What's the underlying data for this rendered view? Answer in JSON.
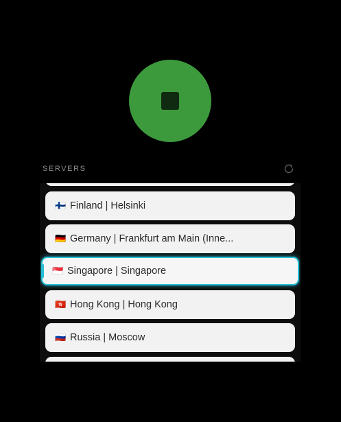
{
  "section": {
    "label": "SERVERS"
  },
  "icons": {
    "power": "stop-square-icon",
    "refresh": "refresh-icon"
  },
  "colors": {
    "connected": "#3c9a3c",
    "selected_border": "#27bfd4"
  },
  "servers": [
    {
      "flag": "🇫🇮",
      "name": "Finland | Helsinki",
      "selected": false
    },
    {
      "flag": "🇩🇪",
      "name": "Germany | Frankfurt am Main (Inne...",
      "selected": false
    },
    {
      "flag": "🇸🇬",
      "name": "Singapore | Singapore",
      "selected": true
    },
    {
      "flag": "🇭🇰",
      "name": "Hong Kong | Hong Kong",
      "selected": false
    },
    {
      "flag": "🇷🇺",
      "name": "Russia | Moscow",
      "selected": false
    }
  ]
}
